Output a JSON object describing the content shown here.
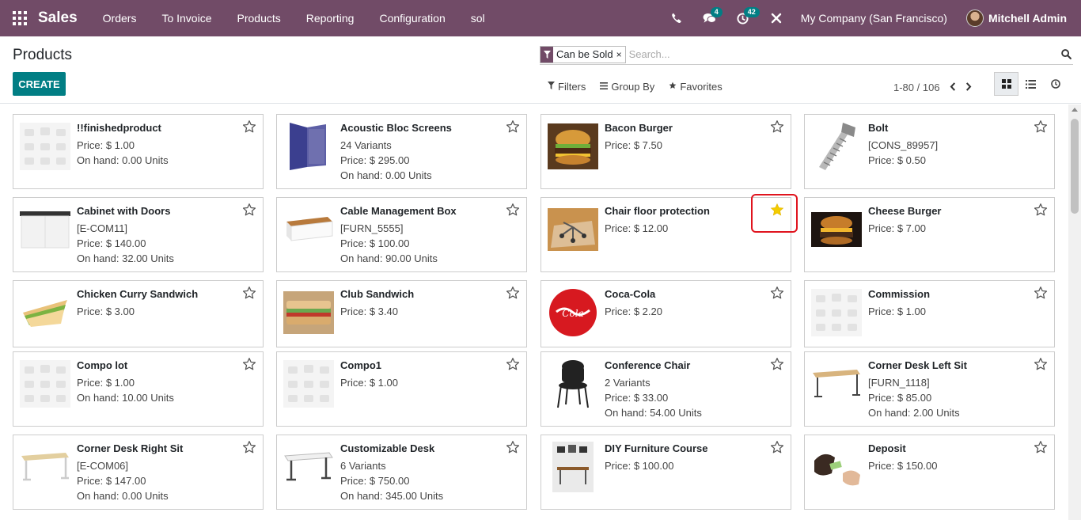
{
  "navbar": {
    "brand": "Sales",
    "menu": [
      "Orders",
      "To Invoice",
      "Products",
      "Reporting",
      "Configuration",
      "sol"
    ],
    "messages_badge": "4",
    "activities_badge": "42",
    "company": "My Company (San Francisco)",
    "user": "Mitchell Admin"
  },
  "control_panel": {
    "title": "Products",
    "create_label": "CREATE",
    "facet_label": "Can be Sold",
    "facet_remove": "×",
    "search_placeholder": "Search...",
    "filters_label": "Filters",
    "groupby_label": "Group By",
    "favorites_label": "Favorites",
    "pager": "1-80 / 106"
  },
  "colors": {
    "brand": "#714B67",
    "accent": "#017e84",
    "star_on": "#f3cc00",
    "highlight": "#e0141e"
  },
  "products": [
    {
      "name": "!!finishedproduct",
      "lines": [
        "Price: $ 1.00",
        "On hand: 0.00 Units"
      ],
      "image": "placeholder",
      "favorite": false
    },
    {
      "name": "Acoustic Bloc Screens",
      "lines": [
        "24 Variants",
        "Price: $ 295.00",
        "On hand: 0.00 Units"
      ],
      "image": "screens",
      "favorite": false
    },
    {
      "name": "Bacon Burger",
      "lines": [
        "Price: $ 7.50"
      ],
      "image": "burger",
      "favorite": false
    },
    {
      "name": "Bolt",
      "lines": [
        "[CONS_89957]",
        "Price: $ 0.50"
      ],
      "image": "bolt",
      "favorite": false
    },
    {
      "name": "Cabinet with Doors",
      "lines": [
        "[E-COM11]",
        "Price: $ 140.00",
        "On hand: 32.00 Units"
      ],
      "image": "cabinet",
      "favorite": false
    },
    {
      "name": "Cable Management Box",
      "lines": [
        "[FURN_5555]",
        "Price: $ 100.00",
        "On hand: 90.00 Units"
      ],
      "image": "cablebox",
      "favorite": false
    },
    {
      "name": "Chair floor protection",
      "lines": [
        "Price: $ 12.00"
      ],
      "image": "chairmat",
      "favorite": true
    },
    {
      "name": "Cheese Burger",
      "lines": [
        "Price: $ 7.00"
      ],
      "image": "cheeseburger",
      "favorite": false
    },
    {
      "name": "Chicken Curry Sandwich",
      "lines": [
        "Price: $ 3.00"
      ],
      "image": "sandwich",
      "favorite": false
    },
    {
      "name": "Club Sandwich",
      "lines": [
        "Price: $ 3.40"
      ],
      "image": "club",
      "favorite": false
    },
    {
      "name": "Coca-Cola",
      "lines": [
        "Price: $ 2.20"
      ],
      "image": "coke",
      "favorite": false
    },
    {
      "name": "Commission",
      "lines": [
        "Price: $ 1.00"
      ],
      "image": "placeholder",
      "favorite": false
    },
    {
      "name": "Compo lot",
      "lines": [
        "Price: $ 1.00",
        "On hand: 10.00 Units"
      ],
      "image": "placeholder",
      "favorite": false
    },
    {
      "name": "Compo1",
      "lines": [
        "Price: $ 1.00"
      ],
      "image": "placeholder",
      "favorite": false
    },
    {
      "name": "Conference Chair",
      "lines": [
        "2 Variants",
        "Price: $ 33.00",
        "On hand: 54.00 Units"
      ],
      "image": "chair",
      "favorite": false
    },
    {
      "name": "Corner Desk Left Sit",
      "lines": [
        "[FURN_1118]",
        "Price: $ 85.00",
        "On hand: 2.00 Units"
      ],
      "image": "desk",
      "favorite": false
    },
    {
      "name": "Corner Desk Right Sit",
      "lines": [
        "[E-COM06]",
        "Price: $ 147.00",
        "On hand: 0.00 Units"
      ],
      "image": "desk2",
      "favorite": false
    },
    {
      "name": "Customizable Desk",
      "lines": [
        "6 Variants",
        "Price: $ 750.00",
        "On hand: 345.00 Units"
      ],
      "image": "desk3",
      "favorite": false
    },
    {
      "name": "DIY Furniture Course",
      "lines": [
        "Price: $ 100.00"
      ],
      "image": "course",
      "favorite": false
    },
    {
      "name": "Deposit",
      "lines": [
        "Price: $ 150.00"
      ],
      "image": "deposit",
      "favorite": false
    }
  ]
}
